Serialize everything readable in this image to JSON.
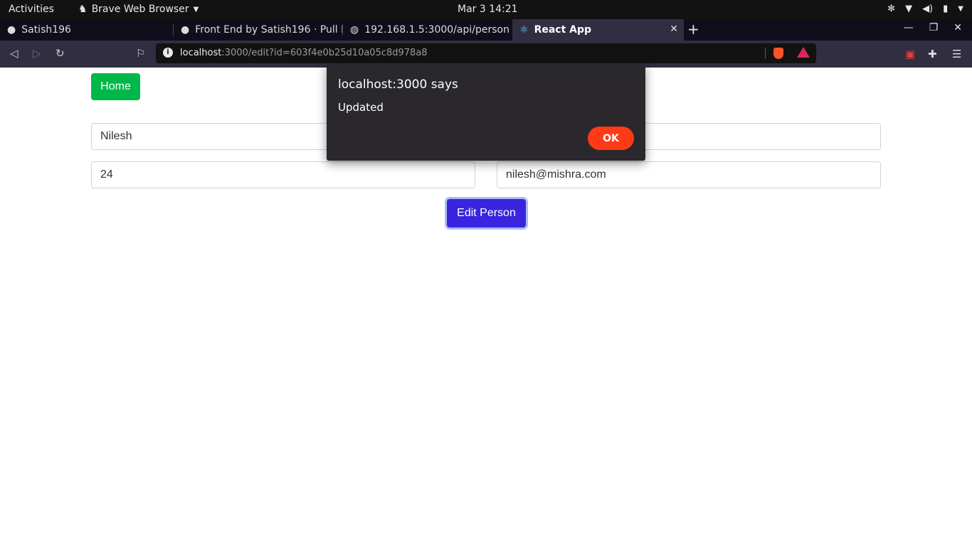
{
  "system": {
    "activities": "Activities",
    "app_menu": "Brave Web Browser",
    "clock": "Mar 3  14:21"
  },
  "tabs": [
    {
      "label": "Satish196"
    },
    {
      "label": "Front End by Satish196 · Pull R"
    },
    {
      "label": "192.168.1.5:3000/api/person"
    },
    {
      "label": "React App",
      "active": true
    }
  ],
  "address_bar": {
    "host": "localhost",
    "rest": ":3000/edit?id=603f4e0b25d10a05c8d978a8"
  },
  "page": {
    "home_label": "Home",
    "name_value": "Nilesh",
    "age_value": "24",
    "email_value": "nilesh@mishra.com",
    "submit_label": "Edit Person"
  },
  "dialog": {
    "title": "localhost:3000 says",
    "message": "Updated",
    "ok_label": "OK"
  },
  "colors": {
    "home_button": "#00b74a",
    "submit_button": "#3b24e0",
    "dialog_ok": "#ff3a16",
    "brave_accent": "#fb542b"
  }
}
